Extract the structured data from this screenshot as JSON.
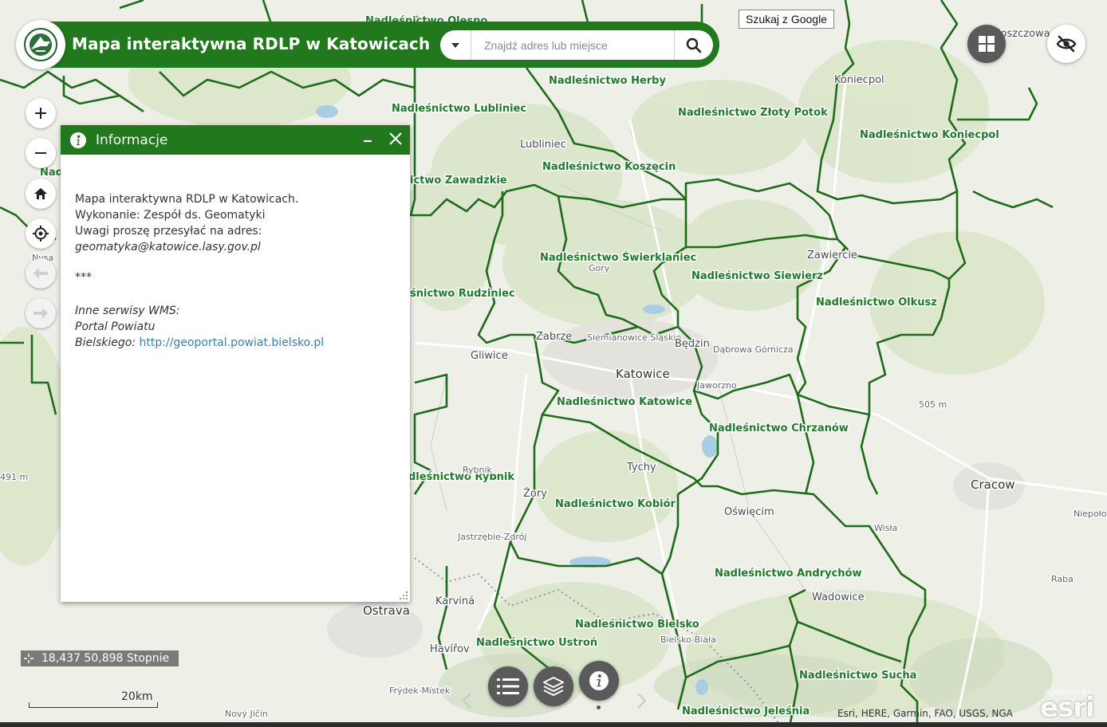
{
  "header": {
    "title": "Mapa interaktywna RDLP w Katowicach",
    "logo_text": "LASY PAŃSTWOWE"
  },
  "search": {
    "placeholder": "Znajdź adres lub miejsce"
  },
  "google_button": "Szukaj z Google",
  "info_panel": {
    "title": "Informacje",
    "lines": [
      "Mapa interaktywna RDLP w Katowicach.",
      "Wykonanie: Zespół ds. Geomatyki",
      "Uwagi proszę przesyłać na adres:",
      "geomatyka@katowice.lasy.gov.pl"
    ],
    "separator": "***",
    "wms_intro": "Inne serwisy WMS:",
    "wms_line1": "Portal Powiatu",
    "wms_line2": "Bielskiego: ",
    "wms_link": "http://geoportal.powiat.bielsko.pl"
  },
  "coordinates": "18,437 50,898 Stopnie",
  "scalebar": "20km",
  "attribution": "Esri, HERE, Garmin, FAO, USGS, NGA",
  "esri_logo": {
    "powered_by": "POWERED BY",
    "name": "esri"
  },
  "colors": {
    "brand_green": "#22781d",
    "forest_boundary": "#1e6b1a",
    "forest_label": "#1f7a2a"
  },
  "icons": {
    "zoom_in": "plus-icon",
    "zoom_out": "minus-icon",
    "home": "home-icon",
    "locate": "crosshair-icon",
    "previous": "arrow-left-icon",
    "next": "arrow-right-icon",
    "apps": "grid-icon",
    "visibility": "eye-slash-icon",
    "legend": "list-icon",
    "layers": "layers-icon",
    "about": "info-icon"
  },
  "forest_districts": [
    "Nadleśnictwo Olesno",
    "Nadleśnictwo Herby",
    "Nadleśnictwo Lubliniec",
    "Nadleśnictwo Złoty Potok",
    "Nadleśnictwo Koniecpol",
    "Nadleśnictwo Koszęcin",
    "ictwo Zawadzkie",
    "Nadleśnictwo Świerklaniec",
    "Nadleśnictwo Siewierz",
    "Nadleśnictwo Olkusz",
    "śnictwo Rudziniec",
    "Nadleśnictwo Katowice",
    "Nadleśnictwo Chrzanów",
    "dleśnictwo Rybnik",
    "Nadleśnictwo Kobiór",
    "Nadleśnictwo Andrychów",
    "Nadleśnictwo Bielsko",
    "Nadleśnictwo Ustroń",
    "Nadleśnictwo Sucha",
    "Nadleśnictwo Jeleśnia",
    "Nad"
  ],
  "places": [
    "Włoszczowa",
    "Koniecpol",
    "Lubliniec",
    "Zawiercie",
    "Gory",
    "Zabrze",
    "Siemianowice Śląskie",
    "Będzin",
    "Dąbrowa Górnicza",
    "Katowice",
    "Gliwice",
    "Jaworzno",
    "Tychy",
    "Rybnik",
    "Żory",
    "Jastrzębie-Zdrój",
    "Oświęcim",
    "Cracow",
    "Wadowice",
    "Karviná",
    "Ostrava",
    "Havířov",
    "Bielsko-Biała",
    "Frýdek-Místek",
    "Nový Jičín",
    "Niepołomice",
    "Nysa",
    "Wisła",
    "Raba",
    "505 m",
    "491 m"
  ]
}
